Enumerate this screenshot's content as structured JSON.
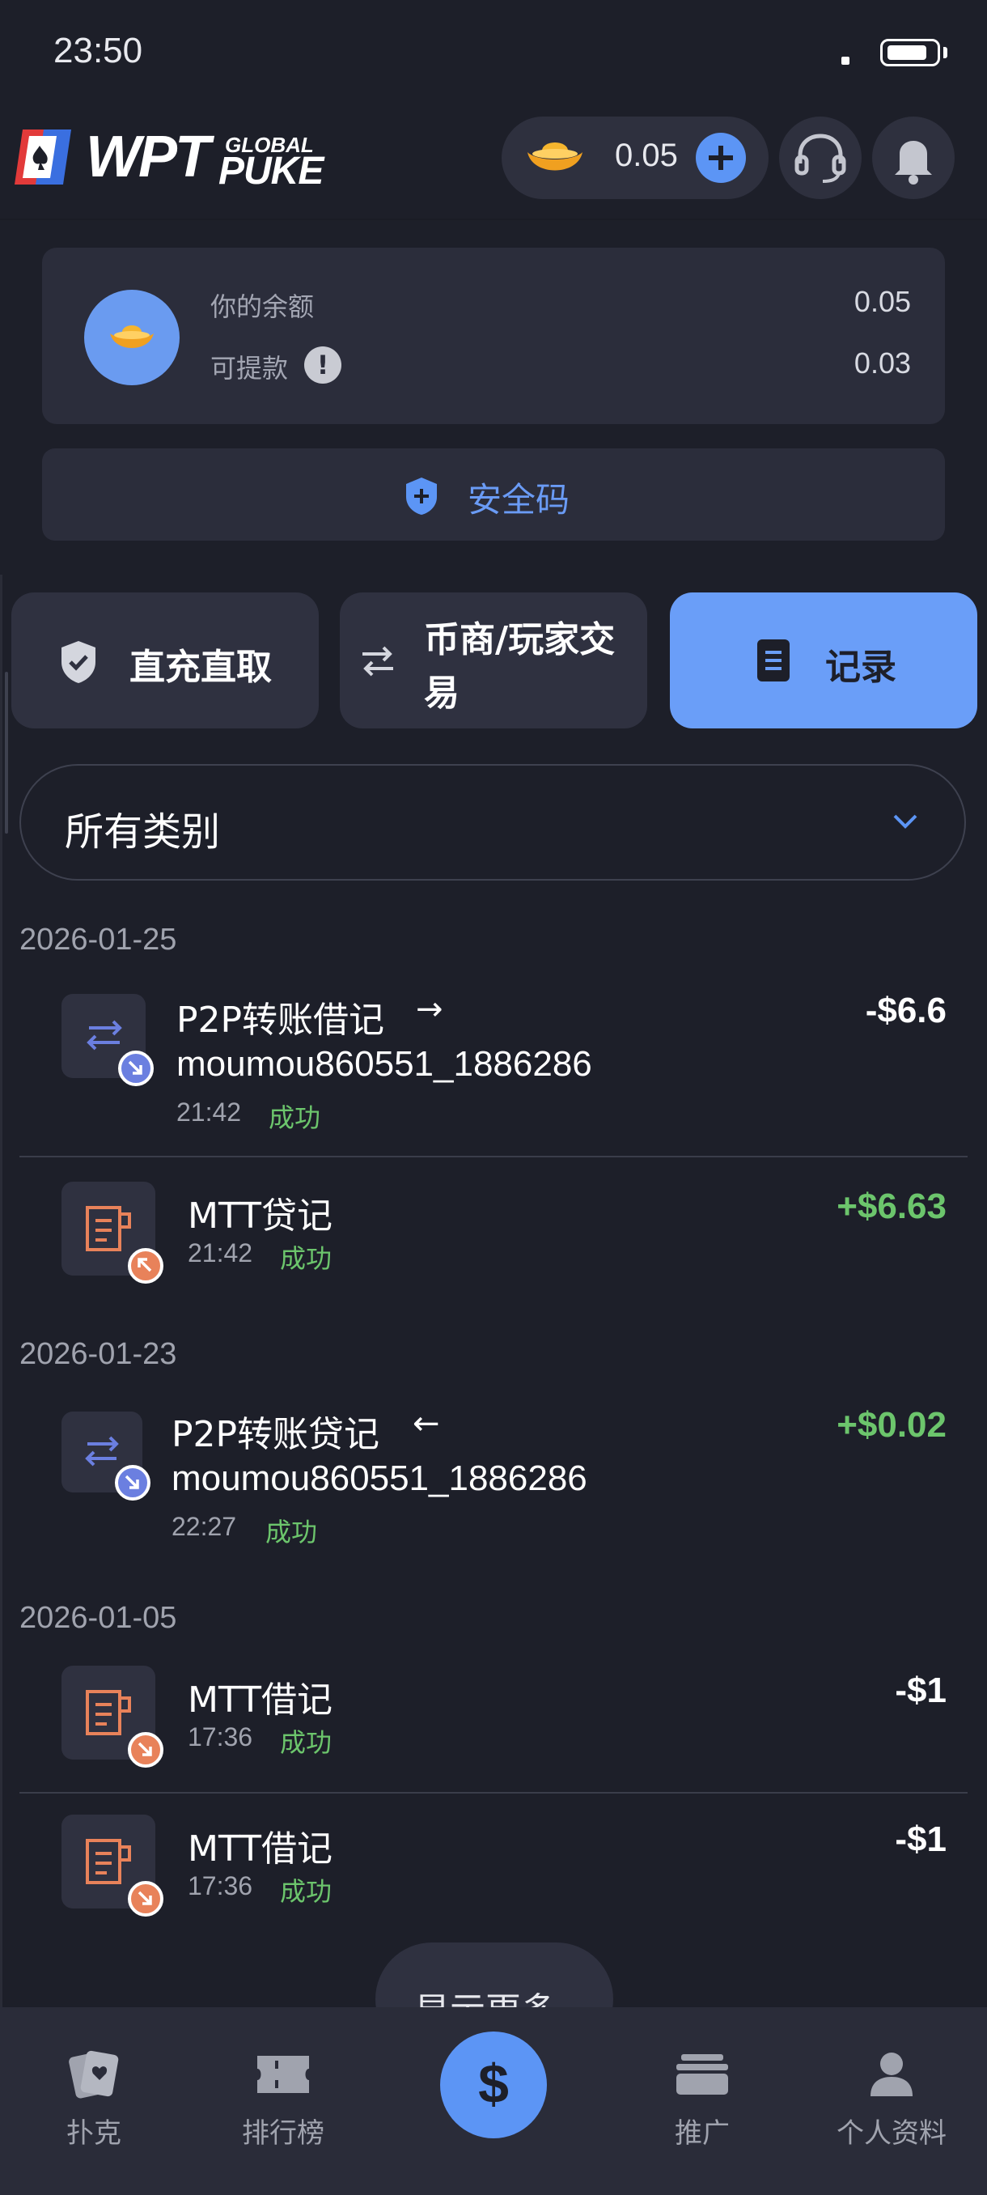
{
  "status_bar": {
    "time": "23:50"
  },
  "header": {
    "logo_text": "WPT",
    "logo_global": "GLOBAL",
    "logo_puke": "PUKE",
    "balance": "0.05",
    "icons": [
      "ingot-icon",
      "plus-icon",
      "headset-icon",
      "bell-icon"
    ]
  },
  "balance_card": {
    "balance_label": "你的余额",
    "balance_value": "0.05",
    "withdrawable_label": "可提款",
    "withdrawable_value": "0.03"
  },
  "security_button": {
    "label": "安全码"
  },
  "tabs": [
    {
      "label": "直充直取",
      "icon": "shield-check-icon"
    },
    {
      "label_line1": "币商/玩家交",
      "label_line2": "易",
      "icon": "swap-arrows-icon"
    },
    {
      "label": "记录",
      "icon": "document-icon",
      "active": true
    }
  ],
  "filter": {
    "selected": "所有类别"
  },
  "groups": [
    {
      "date": "2026-01-25",
      "items": [
        {
          "title": "P2P转账借记",
          "arrow": "→",
          "counterparty": "moumou860551_1886286",
          "time": "21:42",
          "status": "成功",
          "amount": "-$6.6"
        },
        {
          "title": "MTT贷记",
          "time": "21:42",
          "status": "成功",
          "amount": "+$6.63"
        }
      ]
    },
    {
      "date": "2026-01-23",
      "items": [
        {
          "title": "P2P转账贷记",
          "arrow": "←",
          "counterparty": "moumou860551_1886286",
          "time": "22:27",
          "status": "成功",
          "amount": "+$0.02"
        }
      ]
    },
    {
      "date": "2026-01-05",
      "items": [
        {
          "title": "MTT借记",
          "time": "17:36",
          "status": "成功",
          "amount": "-$1"
        },
        {
          "title": "MTT借记",
          "time": "17:36",
          "status": "成功",
          "amount": "-$1"
        }
      ]
    }
  ],
  "show_more": {
    "label": "显示更多"
  },
  "bottom_nav": [
    {
      "label": "扑克",
      "icon": "cards-icon"
    },
    {
      "label": "排行榜",
      "icon": "ticket-icon"
    },
    {
      "label": "",
      "icon": "dollar-icon"
    },
    {
      "label": "推广",
      "icon": "stack-icon"
    },
    {
      "label": "个人资料",
      "icon": "user-icon"
    }
  ],
  "colors": {
    "background": "#1d1f29",
    "accent": "#5c95f5",
    "success": "#6cc56c",
    "debit_badge": "#e8825a",
    "transfer_badge": "#6b7fe0"
  }
}
